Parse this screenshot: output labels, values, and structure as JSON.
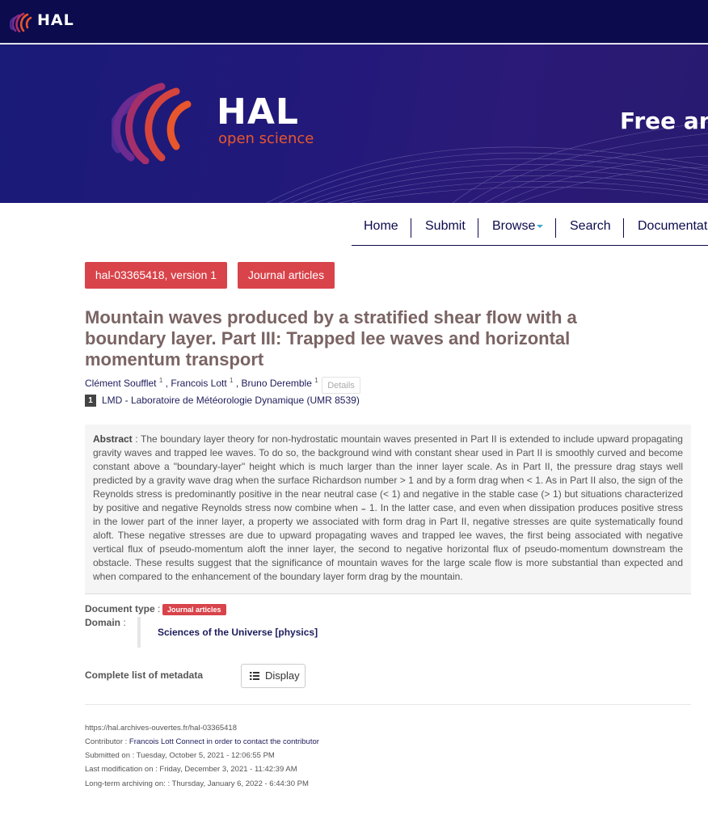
{
  "topbar": {
    "logo_text": "HAL"
  },
  "banner": {
    "logo_title": "HAL",
    "logo_subtitle": "open science",
    "tagline": "Free and"
  },
  "nav": {
    "items": [
      "Home",
      "Submit",
      "Browse",
      "Search",
      "Documentation"
    ]
  },
  "badges": {
    "version": "hal-03365418, version 1",
    "type": "Journal articles"
  },
  "article": {
    "title": "Mountain waves produced by a stratified shear flow with a boundary layer. Part III: Trapped lee waves and horizontal momentum transport",
    "authors": [
      {
        "name": "Clément Soufflet",
        "aff": "1"
      },
      {
        "name": "Francois Lott",
        "aff": "1"
      },
      {
        "name": "Bruno Deremble",
        "aff": "1"
      }
    ],
    "details_label": "Details",
    "affiliation": {
      "num": "1",
      "name": "LMD - Laboratoire de Météorologie Dynamique (UMR 8539)"
    },
    "abstract_label": "Abstract",
    "abstract": "The boundary layer theory for non-hydrostatic mountain waves presented in Part II is extended to include upward propagating gravity waves and trapped lee waves. To do so, the background wind with constant shear used in Part II is smoothly curved and become constant above a \"boundary-layer\" height which is much larger than the inner layer scale. As in Part II, the pressure drag stays well predicted by a gravity wave drag when the surface Richardson number > 1 and by a form drag when < 1. As in Part II also, the sign of the Reynolds stress is predominantly positive in the near neutral case (< 1) and negative in the stable case (> 1) but situations characterized by positive and negative Reynolds stress now combine when ₌ 1. In the latter case, and even when dissipation produces positive stress in the lower part of the inner layer, a property we associated with form drag in Part II, negative stresses are quite systematically found aloft. These negative stresses are due to upward propagating waves and trapped lee waves, the first being associated with negative vertical flux of pseudo-momentum aloft the inner layer, the second to negative horizontal flux of pseudo-momentum downstream the obstacle. These results suggest that the significance of mountain waves for the large scale flow is more substantial than expected and when compared to the enhancement of the boundary layer form drag by the mountain."
  },
  "metadata": {
    "doc_type_label": "Document type",
    "doc_type_value": "Journal articles",
    "domain_label": "Domain",
    "domain_value": "Sciences of the Universe [physics]",
    "complete_label": "Complete list of metadata",
    "display_label": "Display"
  },
  "footer": {
    "url": "https://hal.archives-ouvertes.fr/hal-03365418",
    "contributor_label": "Contributor :",
    "contributor_name": "Francois Lott",
    "contributor_link": "Connect in order to contact the contributor",
    "submitted": "Submitted on : Tuesday, October 5, 2021 - 12:06:55 PM",
    "last_mod": "Last modification on : Friday, December 3, 2021 - 11:42:39 AM",
    "archiving": "Long-term archiving on: : Thursday, January 6, 2022 - 6:44:30 PM"
  },
  "colors": {
    "navy": "#0b0b4d",
    "accent_red": "#d9434a",
    "title_brown": "#7a6463",
    "hal_orange": "#e8562b"
  },
  "icons": [
    "hal-logo-icon",
    "list-icon",
    "caret-down-icon"
  ]
}
